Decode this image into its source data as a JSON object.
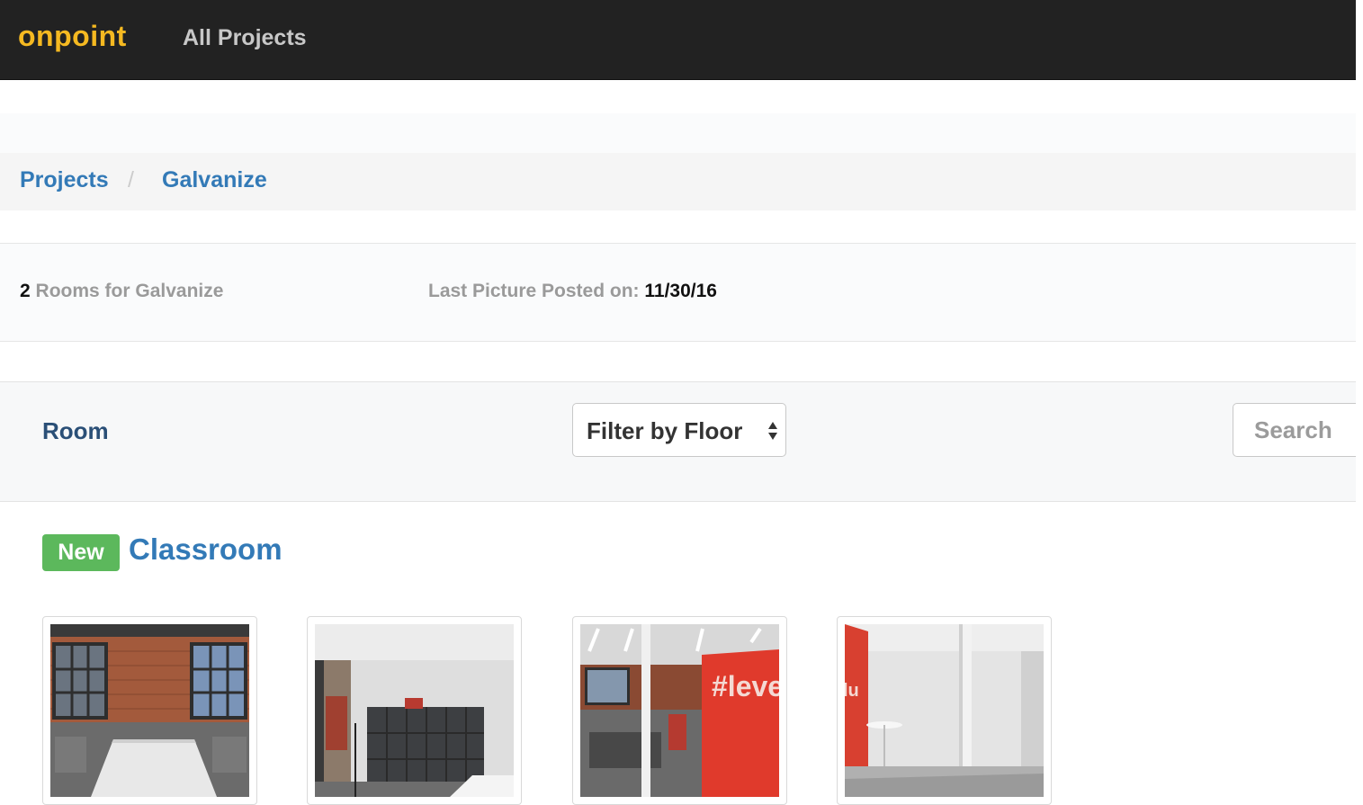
{
  "navbar": {
    "brand": "onpoint",
    "link_all_projects": "All Projects"
  },
  "breadcrumb": {
    "items": [
      "Projects",
      "Galvanize"
    ],
    "separator": "/"
  },
  "summary": {
    "room_count": "2",
    "rooms_label": "Rooms for Galvanize",
    "last_posted_label": "Last Picture Posted on:",
    "last_posted_date": "11/30/16"
  },
  "filters": {
    "room_label": "Room",
    "floor_select": "Filter by Floor",
    "search_placeholder": "Search"
  },
  "room": {
    "badge": "New",
    "title": "Classroom",
    "thumbnails": [
      {
        "name": "classroom-photo-1"
      },
      {
        "name": "classroom-photo-2"
      },
      {
        "name": "classroom-photo-3",
        "text": "#leve"
      },
      {
        "name": "classroom-photo-4",
        "text": "lu"
      }
    ]
  },
  "colors": {
    "navbar_bg": "#222222",
    "brand": "#f5b921",
    "link": "#337ab7",
    "badge_new": "#5cb85c"
  }
}
